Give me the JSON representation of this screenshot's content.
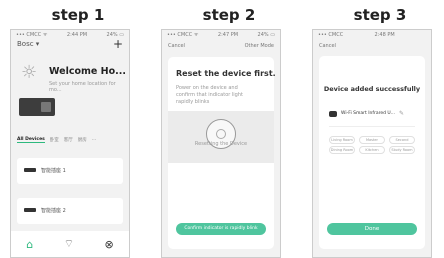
{
  "steps": [
    {
      "title": "step 1"
    },
    {
      "title": "step 2"
    },
    {
      "title": "step 3"
    }
  ],
  "phone1": {
    "status_left": "••• CMCC ᯤ",
    "status_time": "2:44 PM",
    "status_right": "24% ▭",
    "home_label": "Bosc ▾",
    "add_label": "+",
    "welcome": "Welcome Ho...",
    "weather_sub": "Set your home location for mo...",
    "tabs": [
      "All Devices",
      "卧室",
      "客厅",
      "厨房",
      "···"
    ],
    "devices": [
      "智能插座 1",
      "智能插座 2"
    ],
    "nav": [
      "Home",
      "Smart",
      "Me"
    ]
  },
  "phone2": {
    "status_left": "••• CMCC ᯤ",
    "status_time": "2:47 PM",
    "status_right": "24% ▭",
    "cancel": "Cancel",
    "other": "Other Mode",
    "title": "Reset the device first.",
    "body": "Power on the device and confirm that indicator light rapidly blinks",
    "illus_cap": "Resetting the Device",
    "button": "Confirm indicator is rapidly blink"
  },
  "phone3": {
    "status_left": "••• CMCC",
    "status_time": "2:48 PM",
    "cancel": "Cancel",
    "title": "Device added successfully",
    "device": "Wi-Fi Smart Infrared U...",
    "rooms": [
      "Living Room",
      "Master Bedroom",
      "Second Bedroom",
      "Dining Room",
      "Kitchen",
      "Study Room"
    ],
    "button": "Done"
  }
}
